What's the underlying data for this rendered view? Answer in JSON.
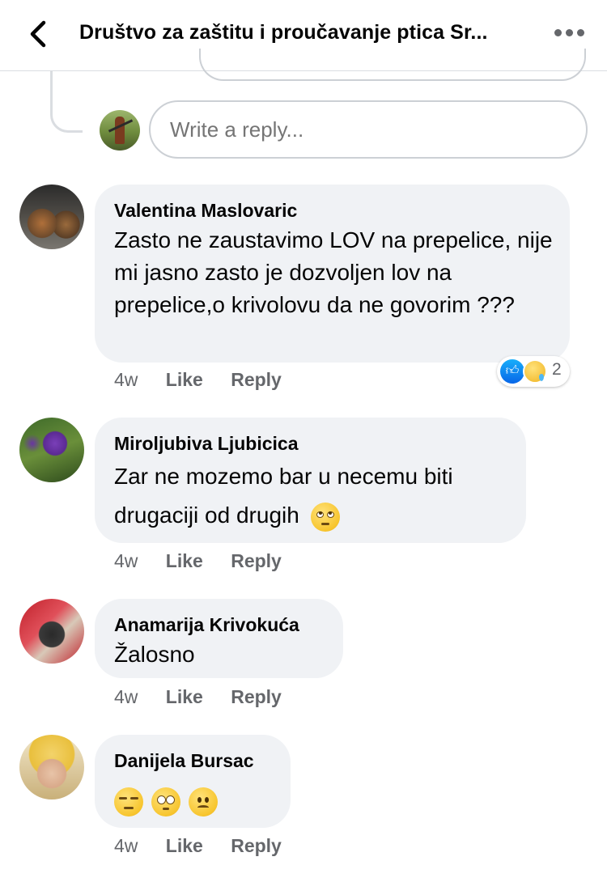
{
  "header": {
    "title": "Društvo za zaštitu i proučavanje ptica Sr..."
  },
  "reply_box": {
    "placeholder": "Write a reply..."
  },
  "comments": [
    {
      "author": "Valentina Maslovaric",
      "text": "Zasto ne zaustavimo LOV na prepelice,  nije mi jasno zasto je dozvoljen lov na prepelice,o krivolovu da ne govorim ???",
      "time": "4w",
      "like_label": "Like",
      "reply_label": "Reply",
      "reactions": {
        "icons": [
          "like-icon",
          "sad-icon"
        ],
        "count": "2"
      }
    },
    {
      "author": "Miroljubiva Ljubicica",
      "text": "Zar ne mozemo bar u necemu biti drugaciji od drugih",
      "emoji": [
        "rolling-eyes-emoji"
      ],
      "time": "4w",
      "like_label": "Like",
      "reply_label": "Reply"
    },
    {
      "author": "Anamarija Krivokuća",
      "text": "Žalosno",
      "time": "4w",
      "like_label": "Like",
      "reply_label": "Reply"
    },
    {
      "author": "Danijela Bursac",
      "emoji": [
        "unamused-emoji",
        "pleading-emoji",
        "frowning-emoji"
      ],
      "time": "4w",
      "like_label": "Like",
      "reply_label": "Reply"
    }
  ],
  "colors": {
    "bubble": "#f0f2f5",
    "secondary_text": "#65676b",
    "primary_text": "#050505",
    "like_blue": "#1877f2"
  }
}
